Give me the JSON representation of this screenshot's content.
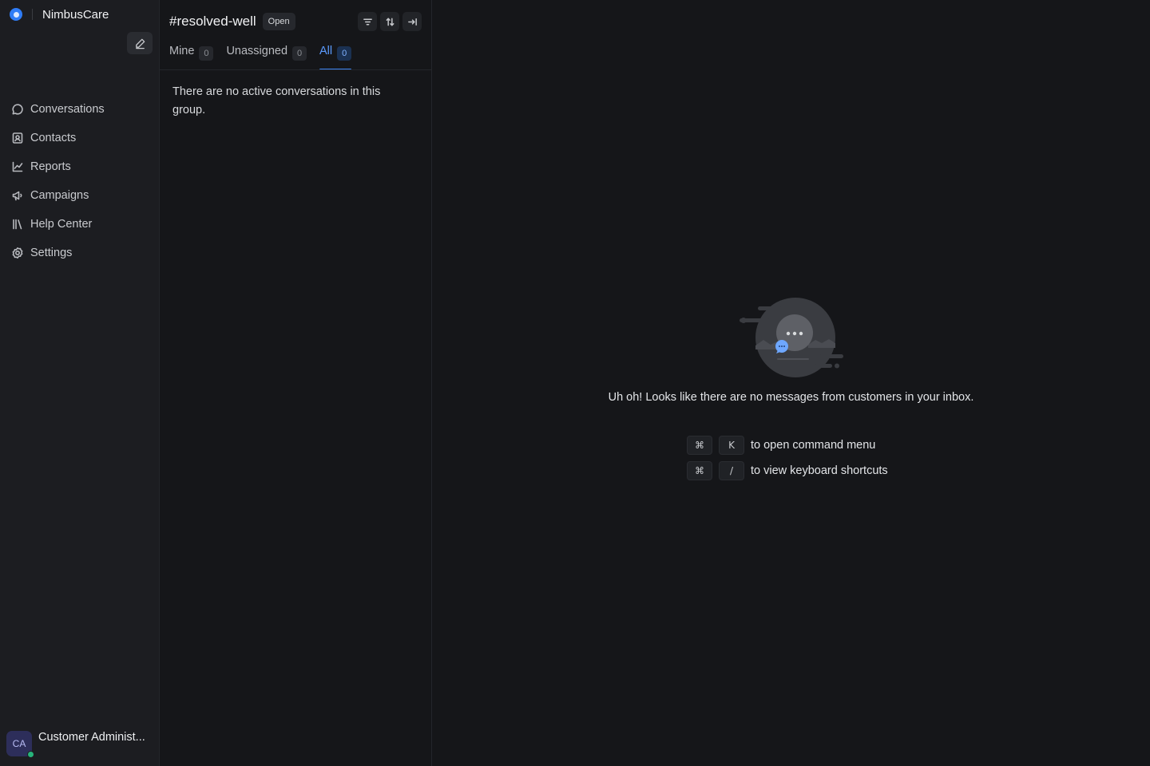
{
  "brand": {
    "name": "NimbusCare"
  },
  "sidebar": {
    "items": [
      {
        "label": "Conversations",
        "icon": "chat-bubble-icon"
      },
      {
        "label": "Contacts",
        "icon": "contact-card-icon"
      },
      {
        "label": "Reports",
        "icon": "line-chart-icon"
      },
      {
        "label": "Campaigns",
        "icon": "megaphone-icon"
      },
      {
        "label": "Help Center",
        "icon": "library-icon"
      },
      {
        "label": "Settings",
        "icon": "gear-icon"
      }
    ],
    "user": {
      "initials": "CA",
      "name": "Customer Administ...",
      "status_color": "#27b37a"
    }
  },
  "list": {
    "title": "#resolved-well",
    "status": "Open",
    "tabs": [
      {
        "label": "Mine",
        "count": "0"
      },
      {
        "label": "Unassigned",
        "count": "0"
      },
      {
        "label": "All",
        "count": "0"
      }
    ],
    "active_tab": "All",
    "empty_text": "There are no active conversations in this group."
  },
  "main": {
    "empty_message": "Uh oh! Looks like there are no messages from customers in your inbox.",
    "shortcuts": [
      {
        "keys": [
          "⌘",
          "K"
        ],
        "text": "to open command menu"
      },
      {
        "keys": [
          "⌘",
          "/"
        ],
        "text": "to view keyboard shortcuts"
      }
    ]
  },
  "colors": {
    "accent": "#3d85f5",
    "background": "#151619",
    "sidebar": "#1c1d21"
  }
}
